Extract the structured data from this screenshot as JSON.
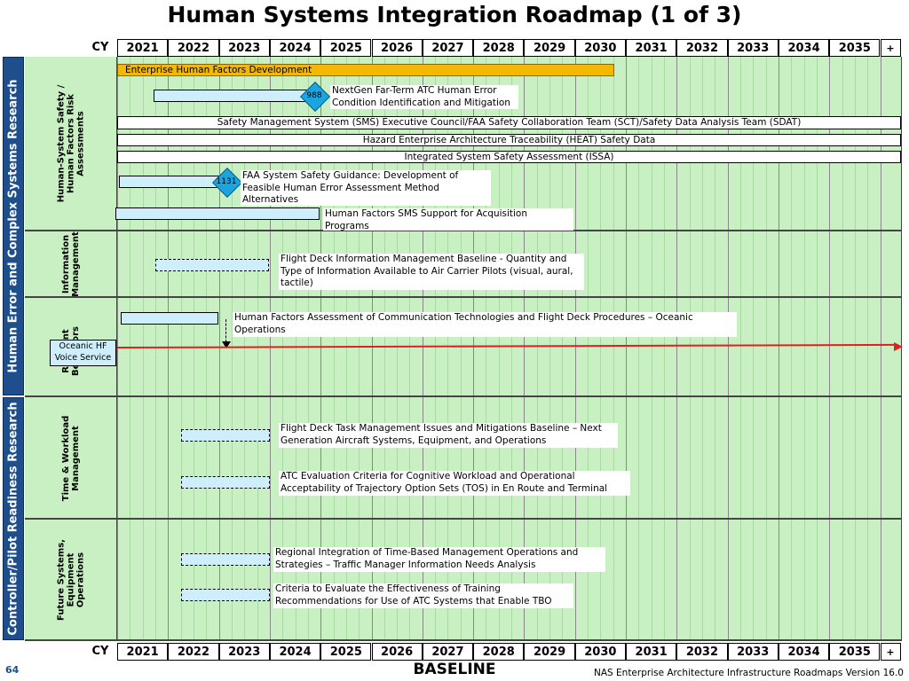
{
  "title": "Human Systems Integration Roadmap (1 of 3)",
  "cy_label": "CY",
  "years": [
    "2021",
    "2022",
    "2023",
    "2024",
    "2025",
    "2026",
    "2027",
    "2028",
    "2029",
    "2030",
    "2031",
    "2032",
    "2033",
    "2034",
    "2035",
    "+"
  ],
  "groups": [
    {
      "name": "Human Error and Complex Systems Research"
    },
    {
      "name": "Controller/Pilot Readiness Research"
    }
  ],
  "subgroups": [
    {
      "name": "Human-System Safety /\nHuman Factors Risk\nAssessments"
    },
    {
      "name": "Information\nManagement"
    },
    {
      "name": "Resilient\nBehaviors"
    },
    {
      "name": "Time & Workload\nManagement"
    },
    {
      "name": "Future Systems,\nEquipment\nOperations"
    }
  ],
  "activities": [
    {
      "label": "Enterprise Human Factors Development"
    },
    {
      "label": "NextGen Far-Term ATC Human Error Condition Identification and Mitigation",
      "milestone": "988"
    },
    {
      "label": "Safety Management System (SMS) Executive Council/FAA Safety Collaboration Team (SCT)/Safety Data Analysis Team (SDAT)"
    },
    {
      "label": "Hazard Enterprise Architecture Traceability (HEAT) Safety Data"
    },
    {
      "label": "Integrated System Safety Assessment (ISSA)"
    },
    {
      "label": "FAA System Safety Guidance: Development of Feasible Human Error Assessment Method Alternatives",
      "milestone": "1131"
    },
    {
      "label": "Human Factors SMS Support for Acquisition Programs"
    },
    {
      "label": "Flight Deck Information Management Baseline - Quantity and Type of Information Available to Air Carrier Pilots (visual, aural, tactile)"
    },
    {
      "label": "Human Factors Assessment of Communication Technologies and Flight Deck Procedures – Oceanic Operations"
    },
    {
      "label": "Flight Deck Task Management Issues and Mitigations Baseline  – Next Generation Aircraft Systems, Equipment, and Operations"
    },
    {
      "label": "ATC Evaluation Criteria for Cognitive Workload and Operational Acceptability of Trajectory Option Sets (TOS) in En Route and Terminal"
    },
    {
      "label": "Regional Integration of Time-Based Management Operations and Strategies – Traffic Manager Information Needs Analysis"
    },
    {
      "label": "Criteria to Evaluate the Effectiveness of Training Recommendations for Use of ATC Systems that Enable TBO"
    }
  ],
  "oceanic_service": "Oceanic HF Voice Service",
  "footer": {
    "page_number": "64",
    "baseline": "BASELINE",
    "version": "NAS Enterprise Architecture Infrastructure Roadmaps Version 16.0"
  },
  "colors": {
    "grid": "#c9f0c2",
    "side_blue": "#1f4e8c",
    "bar_fill": "#cdeefa",
    "orange": "#f5b800",
    "milestone": "#1aa5e0",
    "red_line": "#e02020"
  }
}
